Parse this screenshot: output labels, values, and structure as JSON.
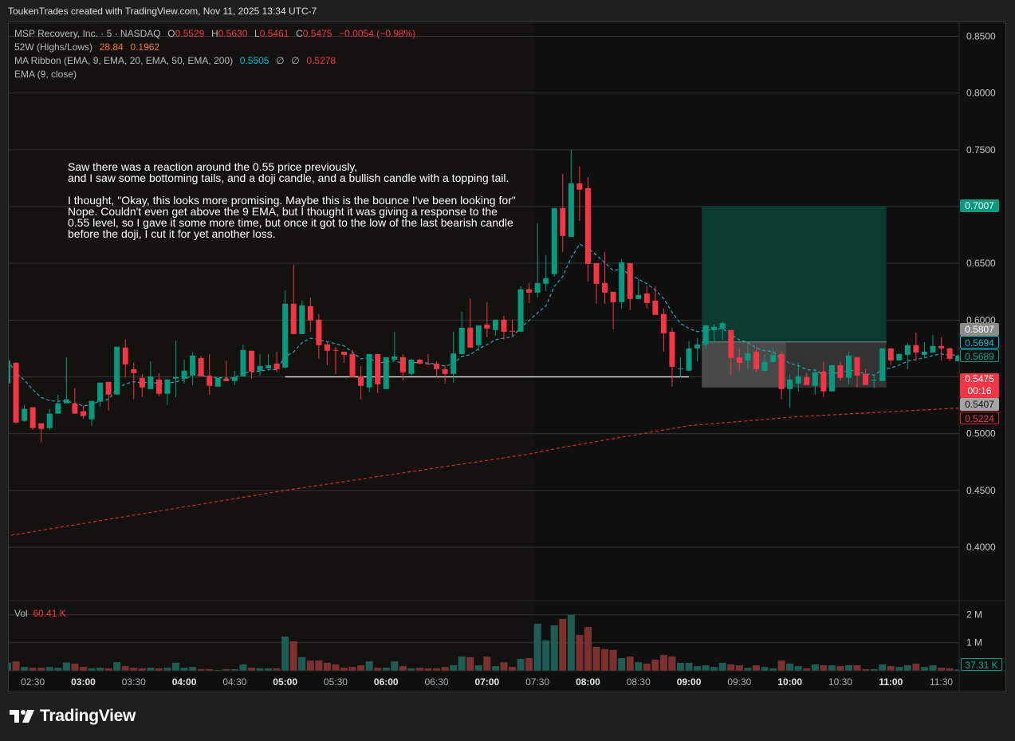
{
  "header": {
    "caption": "ToukenTrades created with TradingView.com, Nov 11, 2025 13:34 UTC-7"
  },
  "legend": {
    "symbol": "MSP Recovery, Inc. · 5 · NASDAQ",
    "o_label": "O",
    "o": "0.5529",
    "h_label": "H",
    "h": "0.5630",
    "l_label": "L",
    "l": "0.5461",
    "c_label": "C",
    "c": "0.5475",
    "change": "−0.0054 (−0.98%)",
    "w52_label": "52W (Highs/Lows)",
    "w52_high": "28.84",
    "w52_low": "0.1962",
    "ribbon_label": "MA Ribbon (EMA, 9, EMA, 20, EMA, 50, EMA, 200)",
    "ribbon_v1": "0.5505",
    "ribbon_v2": "∅",
    "ribbon_v3": "∅",
    "ribbon_v4": "0.5278",
    "ema_label": "EMA (9, close)"
  },
  "note": [
    "Saw there was a reaction around the 0.55 price previously,\nand I saw some bottoming tails, and a doji candle, and a bullish candle with a topping tail.",
    "I thought, \"Okay, this looks more promising. Maybe this is the bounce I've been looking for\"\nNope. Couldn't even get above the 9 EMA, but I thought it was giving a response to the\n0.55 level, so I gave it some more time, but once it got to the low of the last bearish candle\nbefore the doji, I cut it for yet another loss."
  ],
  "volume": {
    "label": "Vol",
    "value": "60.41 K",
    "last_badge": "37.31 K",
    "axis": [
      "2 M",
      "1 M"
    ]
  },
  "badges": {
    "target": "0.7007",
    "entry": "0.5807",
    "ema9": "0.5694",
    "ema9b": "0.5689",
    "last": "0.5475",
    "countdown": "00:16",
    "stop": "0.5407",
    "ema200": "0.5224"
  },
  "logo": {
    "text": "TradingView"
  },
  "colors": {
    "up": "#089981",
    "down": "#f23645",
    "vol_up": "#1e5d56",
    "vol_down": "#7c3130",
    "ema9": "#22a8c4",
    "ema200": "#d32f2f"
  },
  "chart_data": {
    "type": "candlestick",
    "title": "MSP Recovery, Inc. · 5 · NASDAQ",
    "interval_minutes": 5,
    "first_candle_time": "02:15",
    "ylim": [
      0.355,
      0.86
    ],
    "y_ticks": [
      "0.8500",
      "0.8000",
      "0.7500",
      "0.7000",
      "0.6500",
      "0.6000",
      "0.5500",
      "0.5000",
      "0.4500",
      "0.4000"
    ],
    "x_ticks": [
      {
        "i": 3,
        "label": "02:30",
        "bold": false
      },
      {
        "i": 9,
        "label": "03:00",
        "bold": true
      },
      {
        "i": 15,
        "label": "03:30",
        "bold": false
      },
      {
        "i": 21,
        "label": "04:00",
        "bold": true
      },
      {
        "i": 27,
        "label": "04:30",
        "bold": false
      },
      {
        "i": 33,
        "label": "05:00",
        "bold": true
      },
      {
        "i": 39,
        "label": "05:30",
        "bold": false
      },
      {
        "i": 45,
        "label": "06:00",
        "bold": true
      },
      {
        "i": 51,
        "label": "06:30",
        "bold": false
      },
      {
        "i": 57,
        "label": "07:00",
        "bold": true
      },
      {
        "i": 63,
        "label": "07:30",
        "bold": false
      },
      {
        "i": 69,
        "label": "08:00",
        "bold": true
      },
      {
        "i": 75,
        "label": "08:30",
        "bold": false
      },
      {
        "i": 81,
        "label": "09:00",
        "bold": true
      },
      {
        "i": 87,
        "label": "09:30",
        "bold": false
      },
      {
        "i": 93,
        "label": "10:00",
        "bold": true
      },
      {
        "i": 99,
        "label": "10:30",
        "bold": false
      },
      {
        "i": 105,
        "label": "11:00",
        "bold": true
      },
      {
        "i": 111,
        "label": "11:30",
        "bold": false
      }
    ],
    "regular_session_start_index": 63,
    "ohlc": [
      [
        0.5442,
        0.5673,
        0.5435,
        0.5645
      ],
      [
        0.5624,
        0.5631,
        0.5091,
        0.5098
      ],
      [
        0.5112,
        0.5253,
        0.5105,
        0.5218
      ],
      [
        0.5232,
        0.5232,
        0.5035,
        0.5049
      ],
      [
        0.5091,
        0.5091,
        0.4923,
        0.5042
      ],
      [
        0.5049,
        0.5218,
        0.5035,
        0.5176
      ],
      [
        0.5176,
        0.5344,
        0.5176,
        0.5267
      ],
      [
        0.5267,
        0.5673,
        0.5267,
        0.5302
      ],
      [
        0.5267,
        0.54,
        0.5176,
        0.5176
      ],
      [
        0.5197,
        0.5246,
        0.5134,
        0.5155
      ],
      [
        0.5126,
        0.5288,
        0.507,
        0.5288
      ],
      [
        0.5281,
        0.5449,
        0.5239,
        0.5449
      ],
      [
        0.5456,
        0.5456,
        0.5204,
        0.5344
      ],
      [
        0.5344,
        0.5765,
        0.5344,
        0.5765
      ],
      [
        0.5758,
        0.5828,
        0.5498,
        0.561
      ],
      [
        0.5568,
        0.5624,
        0.5302,
        0.5533
      ],
      [
        0.5491,
        0.5526,
        0.5323,
        0.5407
      ],
      [
        0.5393,
        0.5638,
        0.5393,
        0.5505
      ],
      [
        0.5477,
        0.5533,
        0.533,
        0.5351
      ],
      [
        0.5351,
        0.5477,
        0.5253,
        0.5477
      ],
      [
        0.5484,
        0.5821,
        0.5323,
        0.5498
      ],
      [
        0.5484,
        0.5652,
        0.5442,
        0.5554
      ],
      [
        0.5512,
        0.5722,
        0.5428,
        0.5687
      ],
      [
        0.5666,
        0.5687,
        0.5505,
        0.5505
      ],
      [
        0.5512,
        0.5701,
        0.5344,
        0.5421
      ],
      [
        0.5414,
        0.5484,
        0.5414,
        0.5491
      ],
      [
        0.5484,
        0.5645,
        0.5463,
        0.5463
      ],
      [
        0.5463,
        0.5554,
        0.5428,
        0.5498
      ],
      [
        0.5505,
        0.5786,
        0.5505,
        0.5737
      ],
      [
        0.573,
        0.573,
        0.5484,
        0.5547
      ],
      [
        0.5554,
        0.5701,
        0.5512,
        0.5596
      ],
      [
        0.5575,
        0.5701,
        0.5575,
        0.5603
      ],
      [
        0.5617,
        0.5722,
        0.554,
        0.5568
      ],
      [
        0.5582,
        0.6263,
        0.5575,
        0.6144
      ],
      [
        0.6144,
        0.6488,
        0.5877,
        0.5877
      ],
      [
        0.5877,
        0.6172,
        0.5877,
        0.613
      ],
      [
        0.6123,
        0.62,
        0.5898,
        0.5997
      ],
      [
        0.6004,
        0.6053,
        0.5659,
        0.5779
      ],
      [
        0.5786,
        0.58,
        0.5603,
        0.573
      ],
      [
        0.5737,
        0.5765,
        0.5526,
        0.573
      ],
      [
        0.5722,
        0.5722,
        0.5624,
        0.5694
      ],
      [
        0.5701,
        0.5737,
        0.5498,
        0.5498
      ],
      [
        0.5505,
        0.5596,
        0.5302,
        0.5421
      ],
      [
        0.5407,
        0.5701,
        0.5365,
        0.5701
      ],
      [
        0.5701,
        0.5701,
        0.5358,
        0.5435
      ],
      [
        0.5393,
        0.5673,
        0.5393,
        0.5673
      ],
      [
        0.5652,
        0.5898,
        0.5652,
        0.568
      ],
      [
        0.5673,
        0.5701,
        0.547,
        0.554
      ],
      [
        0.5526,
        0.5659,
        0.5512,
        0.5652
      ],
      [
        0.5652,
        0.5659,
        0.561,
        0.5617
      ],
      [
        0.5617,
        0.5701,
        0.561,
        0.561
      ],
      [
        0.5617,
        0.5638,
        0.5498,
        0.5568
      ],
      [
        0.5568,
        0.5603,
        0.5442,
        0.5526
      ],
      [
        0.5526,
        0.5898,
        0.5449,
        0.5708
      ],
      [
        0.5701,
        0.6074,
        0.5701,
        0.5933
      ],
      [
        0.5933,
        0.6193,
        0.5758,
        0.5758
      ],
      [
        0.5779,
        0.5954,
        0.573,
        0.5954
      ],
      [
        0.5961,
        0.6158,
        0.5849,
        0.5926
      ],
      [
        0.5912,
        0.6004,
        0.5863,
        0.6004
      ],
      [
        0.6004,
        0.6039,
        0.5828,
        0.5898
      ],
      [
        0.5905,
        0.6004,
        0.5856,
        0.5898
      ],
      [
        0.5898,
        0.6299,
        0.5898,
        0.6271
      ],
      [
        0.6271,
        0.6327,
        0.6151,
        0.6242
      ],
      [
        0.6242,
        0.6854,
        0.62,
        0.6327
      ],
      [
        0.632,
        0.6573,
        0.6256,
        0.6369
      ],
      [
        0.6404,
        0.6987,
        0.6383,
        0.6987
      ],
      [
        0.6987,
        0.7289,
        0.6601,
        0.6741
      ],
      [
        0.6734,
        0.75,
        0.6734,
        0.7205
      ],
      [
        0.7205,
        0.7353,
        0.6875,
        0.7149
      ],
      [
        0.7163,
        0.7261,
        0.6341,
        0.6495
      ],
      [
        0.6502,
        0.6502,
        0.6144,
        0.632
      ],
      [
        0.6327,
        0.6601,
        0.6144,
        0.6242
      ],
      [
        0.6249,
        0.6249,
        0.5919,
        0.6158
      ],
      [
        0.6158,
        0.6537,
        0.6102,
        0.6509
      ],
      [
        0.6502,
        0.6502,
        0.6088,
        0.6186
      ],
      [
        0.6186,
        0.6362,
        0.6186,
        0.6221
      ],
      [
        0.6235,
        0.6299,
        0.6102,
        0.6151
      ],
      [
        0.6172,
        0.6299,
        0.6046,
        0.6046
      ],
      [
        0.6053,
        0.6102,
        0.5722,
        0.5884
      ],
      [
        0.5898,
        0.5933,
        0.5414,
        0.5589
      ],
      [
        0.5568,
        0.5673,
        0.5498,
        0.5575
      ],
      [
        0.5554,
        0.5814,
        0.5554,
        0.5751
      ],
      [
        0.5751,
        0.5842,
        0.5638,
        0.5786
      ],
      [
        0.5786,
        0.5954,
        0.5751,
        0.5954
      ],
      [
        0.5912,
        0.5961,
        0.5814,
        0.594
      ],
      [
        0.5926,
        0.5989,
        0.5821,
        0.5975
      ],
      [
        0.5912,
        0.5912,
        0.5512,
        0.5666
      ],
      [
        0.5673,
        0.5751,
        0.5554,
        0.5624
      ],
      [
        0.5645,
        0.5779,
        0.5568,
        0.5708
      ],
      [
        0.5722,
        0.5758,
        0.554,
        0.5568
      ],
      [
        0.5554,
        0.5701,
        0.5554,
        0.5631
      ],
      [
        0.5631,
        0.5758,
        0.5631,
        0.5694
      ],
      [
        0.5701,
        0.573,
        0.5302,
        0.5393
      ],
      [
        0.5393,
        0.5526,
        0.5225,
        0.5477
      ],
      [
        0.5442,
        0.5624,
        0.5372,
        0.5505
      ],
      [
        0.5498,
        0.5533,
        0.5428,
        0.5428
      ],
      [
        0.5421,
        0.5575,
        0.5344,
        0.554
      ],
      [
        0.5547,
        0.5638,
        0.5323,
        0.5372
      ],
      [
        0.5372,
        0.5603,
        0.5372,
        0.5603
      ],
      [
        0.5603,
        0.5638,
        0.547,
        0.5491
      ],
      [
        0.5491,
        0.5722,
        0.5435,
        0.5687
      ],
      [
        0.5673,
        0.5673,
        0.5407,
        0.5512
      ],
      [
        0.5526,
        0.5568,
        0.5428,
        0.5428
      ],
      [
        0.547,
        0.5512,
        0.54,
        0.5475
      ],
      [
        0.5463,
        0.5751,
        0.5463,
        0.5751
      ],
      [
        0.5751,
        0.5751,
        0.5603,
        0.5645
      ],
      [
        0.5645,
        0.5708,
        0.5645,
        0.5701
      ],
      [
        0.5694,
        0.58,
        0.5568,
        0.5779
      ],
      [
        0.5779,
        0.5891,
        0.5638,
        0.5715
      ],
      [
        0.5694,
        0.5807,
        0.5673,
        0.5722
      ],
      [
        0.5715,
        0.587,
        0.5715,
        0.5772
      ],
      [
        0.5772,
        0.5849,
        0.5645,
        0.5751
      ],
      [
        0.5751,
        0.5758,
        0.5638,
        0.5659
      ],
      [
        0.5638,
        0.5687,
        0.5638,
        0.5687
      ]
    ],
    "volume_millions": [
      0.29,
      0.33,
      0.13,
      0.1,
      0.1,
      0.13,
      0.1,
      0.29,
      0.25,
      0.13,
      0.08,
      0.1,
      0.08,
      0.3,
      0.16,
      0.1,
      0.08,
      0.1,
      0.08,
      0.1,
      0.28,
      0.1,
      0.13,
      0.05,
      0.05,
      0.02,
      0.05,
      0.05,
      0.22,
      0.1,
      0.08,
      0.08,
      0.08,
      1.22,
      1.05,
      0.48,
      0.36,
      0.36,
      0.28,
      0.22,
      0.1,
      0.13,
      0.19,
      0.33,
      0.1,
      0.1,
      0.33,
      0.16,
      0.08,
      0.1,
      0.08,
      0.08,
      0.13,
      0.19,
      0.5,
      0.48,
      0.19,
      0.5,
      0.16,
      0.3,
      0.13,
      0.42,
      0.45,
      1.68,
      1.08,
      1.62,
      1.85,
      2.0,
      1.28,
      1.56,
      0.85,
      0.77,
      0.74,
      0.45,
      0.5,
      0.3,
      0.25,
      0.39,
      0.56,
      0.5,
      0.28,
      0.28,
      0.16,
      0.19,
      0.13,
      0.28,
      0.22,
      0.19,
      0.1,
      0.19,
      0.13,
      0.08,
      0.36,
      0.25,
      0.16,
      0.08,
      0.22,
      0.19,
      0.19,
      0.16,
      0.19,
      0.19,
      0.05,
      0.05,
      0.22,
      0.16,
      0.13,
      0.19,
      0.25,
      0.13,
      0.19,
      0.1,
      0.08,
      0.037
    ],
    "ema200_points": [
      [
        0,
        0.41
      ],
      [
        33,
        0.45
      ],
      [
        62,
        0.482
      ],
      [
        66,
        0.488
      ],
      [
        81,
        0.507
      ],
      [
        94,
        0.515
      ],
      [
        113,
        0.5225
      ]
    ],
    "support_line": {
      "price": 0.55,
      "from_index": 33,
      "to_index": 81
    },
    "position": {
      "from_index": 83,
      "to_index": 104,
      "target": 0.7007,
      "entry": 0.5807,
      "stop": 0.5407,
      "filled_to_index": 93
    }
  }
}
